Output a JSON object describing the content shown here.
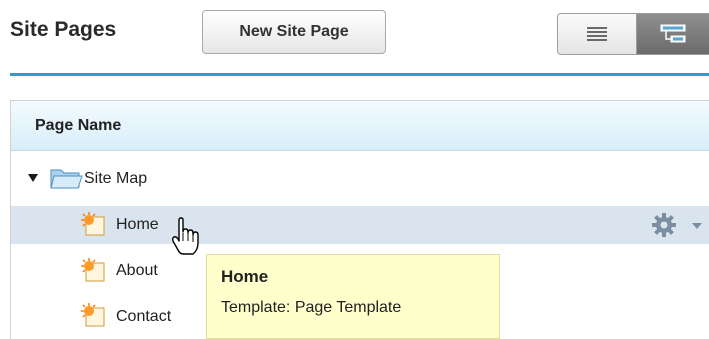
{
  "header": {
    "title": "Site Pages",
    "new_button_label": "New Site Page"
  },
  "view_toggle": {
    "options": [
      {
        "icon": "list-view-icon",
        "selected": false
      },
      {
        "icon": "tree-view-icon",
        "selected": true
      }
    ]
  },
  "table": {
    "column_header": "Page Name",
    "tree": {
      "root": {
        "label": "Site Map",
        "icon": "folder-open-icon",
        "expanded": true
      },
      "children": [
        {
          "label": "Home",
          "icon": "page-icon",
          "highlighted": true
        },
        {
          "label": "About",
          "icon": "page-icon"
        },
        {
          "label": "Contact",
          "icon": "page-icon"
        }
      ]
    }
  },
  "tooltip": {
    "title": "Home",
    "subtitle": "Template: Page Template"
  },
  "colors": {
    "accent_rule": "#2f9bc4",
    "row_highlight": "#d9e4ee",
    "tooltip_bg": "#ffffcc",
    "header_gradient_end": "#d7eef8"
  }
}
